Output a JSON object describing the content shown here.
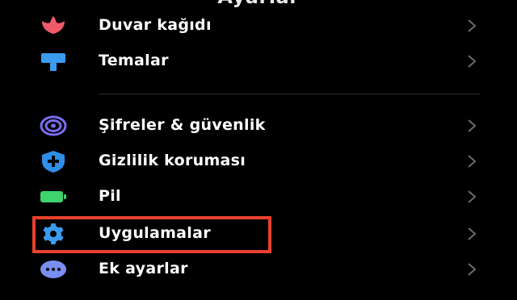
{
  "header": {
    "title": "Ayarlar"
  },
  "colors": {
    "background": "#000000",
    "text": "#ffffff",
    "chevron": "#6b6b6b",
    "separator": "#2c2c2c",
    "highlight": "#e8412c",
    "icon_wallpaper": "#f05a6b",
    "icon_themes": "#3a9cf0",
    "icon_passwords": "#7b6cf2",
    "icon_privacy": "#2f8ee8",
    "icon_battery": "#3ed36c",
    "icon_apps": "#3a9cf0",
    "icon_more": "#7b8ff2"
  },
  "settings": {
    "items": [
      {
        "label": "Duvar kağıdı",
        "icon": "wallpaper-icon"
      },
      {
        "label": "Temalar",
        "icon": "themes-icon"
      },
      {
        "label": "Şifreler & güvenlik",
        "icon": "fingerprint-icon"
      },
      {
        "label": "Gizlilik koruması",
        "icon": "privacy-shield-icon"
      },
      {
        "label": "Pil",
        "icon": "battery-icon"
      },
      {
        "label": "Uygulamalar",
        "icon": "gear-icon"
      },
      {
        "label": "Ek ayarlar",
        "icon": "more-dots-icon"
      }
    ],
    "chevron": "chevron-right-icon",
    "highlighted_item": "Uygulamalar"
  }
}
